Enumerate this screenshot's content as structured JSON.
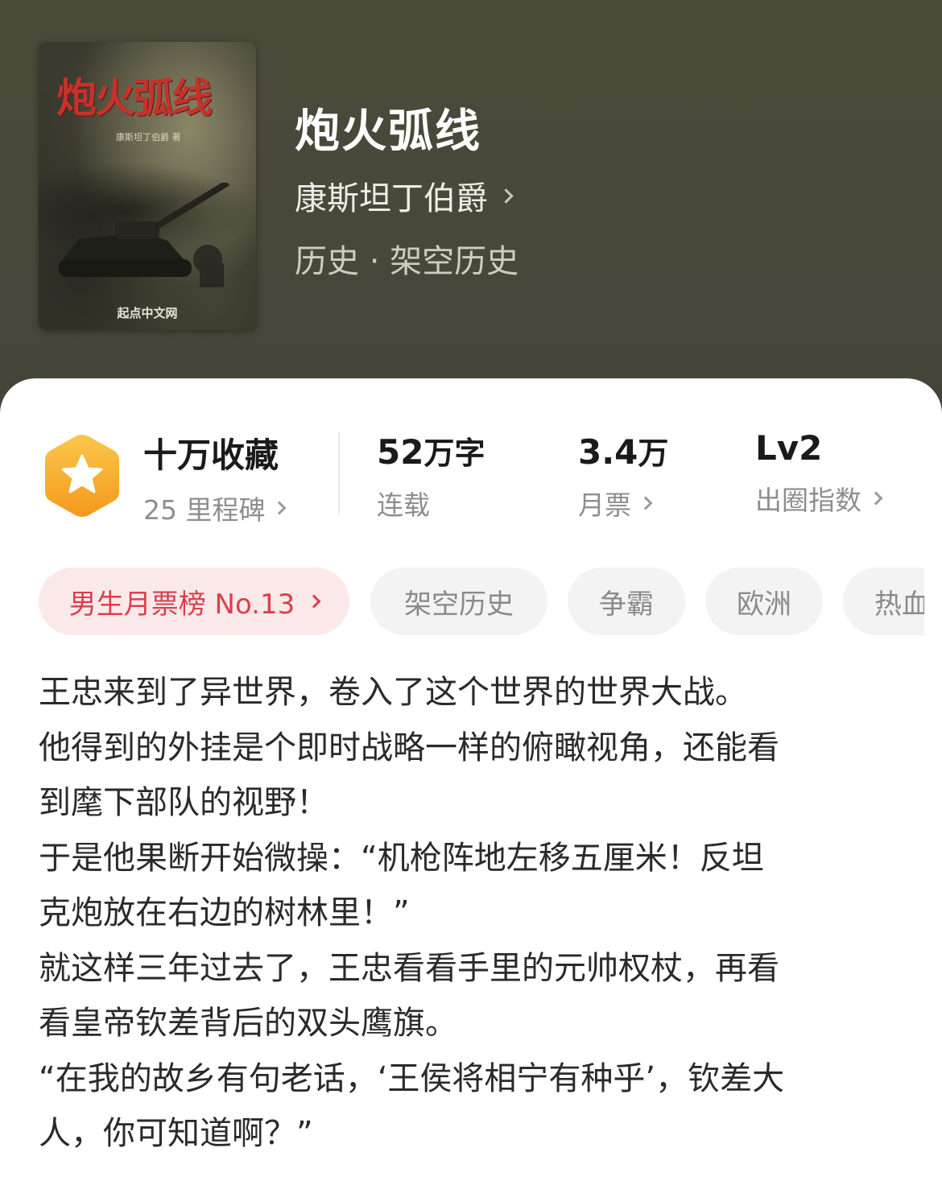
{
  "book": {
    "title": "炮火弧线",
    "author": "康斯坦丁伯爵",
    "category": "历史",
    "separator": " · ",
    "subcategory": "架空历史"
  },
  "cover": {
    "title": "炮火弧线",
    "author_credit": "康斯坦丁伯爵 著",
    "publisher": "起点中文网"
  },
  "stats": {
    "collections": {
      "value": "十万收藏",
      "sub": "25 里程碑"
    },
    "words": {
      "value": "52",
      "unit": "万字",
      "sub": "连载"
    },
    "monthly_tickets": {
      "value": "3.4",
      "unit": "万",
      "sub": "月票"
    },
    "popularity": {
      "value": "Lv2",
      "sub": "出圈指数"
    }
  },
  "tags": [
    {
      "label": "男生月票榜 No.13",
      "type": "rank"
    },
    {
      "label": "架空历史"
    },
    {
      "label": "争霸"
    },
    {
      "label": "欧洲"
    },
    {
      "label": "热血"
    }
  ],
  "description": [
    "王忠来到了异世界，卷入了这个世界的世界大战。",
    "他得到的外挂是个即时战略一样的俯瞰视角，还能看",
    "到麾下部队的视野！",
    "于是他果断开始微操：“机枪阵地左移五厘米！反坦",
    "克炮放在右边的树林里！”",
    "就这样三年过去了，王忠看看手里的元帅权杖，再看",
    "看皇帝钦差背后的双头鹰旗。",
    "“在我的故乡有句老话，‘王侯将相宁有种乎’，钦差大",
    "人，你可知道啊？”"
  ],
  "colors": {
    "header_bg": "#4a4838",
    "rank_tag_bg": "#fbe9ea",
    "rank_tag_text": "#d9404c",
    "badge": "#f5a623"
  },
  "icons": {
    "badge": "star-hexagon-icon",
    "chevron": "chevron-right-icon"
  }
}
